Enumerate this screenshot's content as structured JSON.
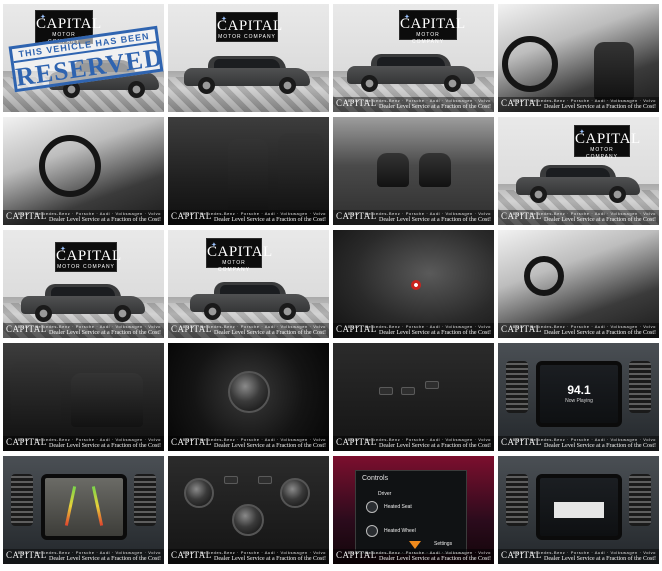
{
  "gallery": {
    "watermark": {
      "brand": "CAPITAL",
      "makes": "BMW · Mercedes-Benz · Porsche · Audi · Volkswagen · Volvo",
      "tagline": "Dealer Level Service at a Fraction of the Cost!"
    },
    "sign": {
      "name": "CAPITAL",
      "sub": "MOTOR COMPANY"
    },
    "stamp": {
      "top": "THIS VEHICLE HAS BEEN",
      "main": "RESERVED"
    },
    "radio": {
      "freq": "94.1",
      "sub": "Now Playing"
    },
    "controls": {
      "title": "Controls",
      "driver": "Driver",
      "heated_seat": "Heated Seat",
      "heated_wheel": "Heated Wheel",
      "settings": "Settings"
    },
    "thumbnails": [
      {
        "id": "1",
        "scene": "exterior-front-reserved"
      },
      {
        "id": "2",
        "scene": "exterior-side"
      },
      {
        "id": "3",
        "scene": "exterior-rear-quarter"
      },
      {
        "id": "4",
        "scene": "interior-dash"
      },
      {
        "id": "5",
        "scene": "interior-driver"
      },
      {
        "id": "6",
        "scene": "front-seats"
      },
      {
        "id": "7",
        "scene": "cargo"
      },
      {
        "id": "8",
        "scene": "exterior-front-quarter"
      },
      {
        "id": "9",
        "scene": "exterior-side-2"
      },
      {
        "id": "10",
        "scene": "exterior-rear"
      },
      {
        "id": "11",
        "scene": "start-button"
      },
      {
        "id": "12",
        "scene": "interior-passenger"
      },
      {
        "id": "13",
        "scene": "rear-seats"
      },
      {
        "id": "14",
        "scene": "drive-selector"
      },
      {
        "id": "15",
        "scene": "console-buttons"
      },
      {
        "id": "16",
        "scene": "radio-screen"
      },
      {
        "id": "17",
        "scene": "backup-camera"
      },
      {
        "id": "18",
        "scene": "climate-controls"
      },
      {
        "id": "19",
        "scene": "controls-menu"
      },
      {
        "id": "20",
        "scene": "screen-off"
      }
    ]
  }
}
